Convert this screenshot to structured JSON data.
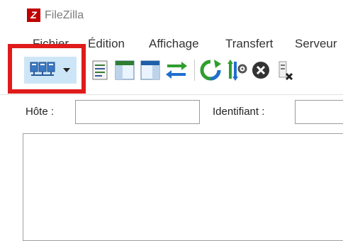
{
  "titlebar": {
    "logo_text": "Z",
    "title": "FileZilla"
  },
  "menu": {
    "items": [
      "Fichier",
      "Édition",
      "Affichage",
      "Transfert",
      "Serveur"
    ]
  },
  "toolbar": {
    "buttons": [
      "site-manager-icon",
      "dropdown-arrow-icon",
      "message-log-icon",
      "local-tree-icon",
      "remote-tree-icon",
      "transfer-queue-icon",
      "refresh-icon",
      "process-queue-icon",
      "cancel-icon",
      "disconnect-icon"
    ],
    "highlight_color": "#e01b1b"
  },
  "quickconnect": {
    "host_label": "Hôte :",
    "host_value": "",
    "user_label": "Identifiant :",
    "user_value": ""
  },
  "colors": {
    "logo_bg": "#bf0000",
    "refresh_green": "#2f9e2f",
    "transfer_blue": "#1f6fcf"
  }
}
